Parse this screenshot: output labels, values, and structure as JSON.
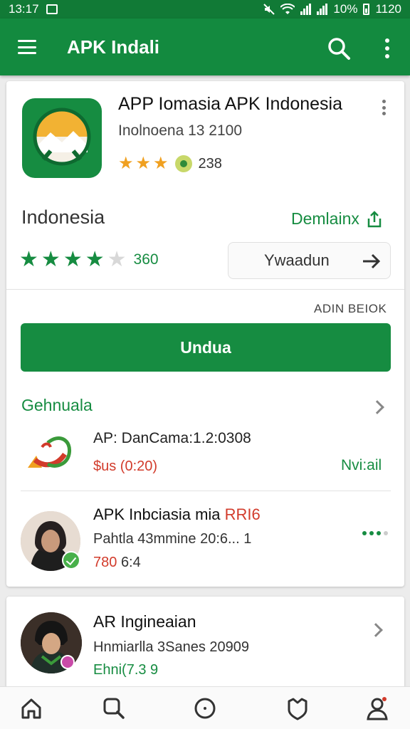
{
  "status_bar": {
    "time": "13:17",
    "battery_percent": "10%",
    "clock_right": "1120"
  },
  "app_bar": {
    "title": "APK Indali"
  },
  "app_card": {
    "title": "APP Iomasia APK Indonesia",
    "subtitle": "Inolnoena 13 2100",
    "small_rating": {
      "stars": 3,
      "count": "238"
    },
    "section_label": "Indonesia",
    "download_link": "Demlainx",
    "rating": {
      "stars": 4,
      "max": 5,
      "count": "360"
    },
    "secondary_button": "Ywaadun",
    "small_caps_label": "ADIN BEIOK",
    "primary_button": "Undua",
    "list_header": "Gehnuala",
    "items": [
      {
        "title": "AP: DanCama:1.2:0308",
        "price": "$us (0:20)",
        "status": "Nvi:ail"
      },
      {
        "title": "APK Inbciasia mia",
        "tag": "RRI6",
        "subtitle": "Pahtla 43mmine 20:6... 1",
        "meta_red": "780",
        "meta": "6:4"
      }
    ]
  },
  "second_card": {
    "title": "AR Ingineaian",
    "subtitle": "Hnmiarlla 3Sanes 20909",
    "meta": "Ehni(7.3 9"
  },
  "colors": {
    "primary": "#138a3f",
    "status_bar": "#117a36",
    "accent_red": "#d23b2b",
    "star_orange": "#f0a020"
  },
  "bottom_nav": [
    "home-icon",
    "search-icon",
    "circle-icon",
    "shield-icon",
    "profile-icon"
  ]
}
